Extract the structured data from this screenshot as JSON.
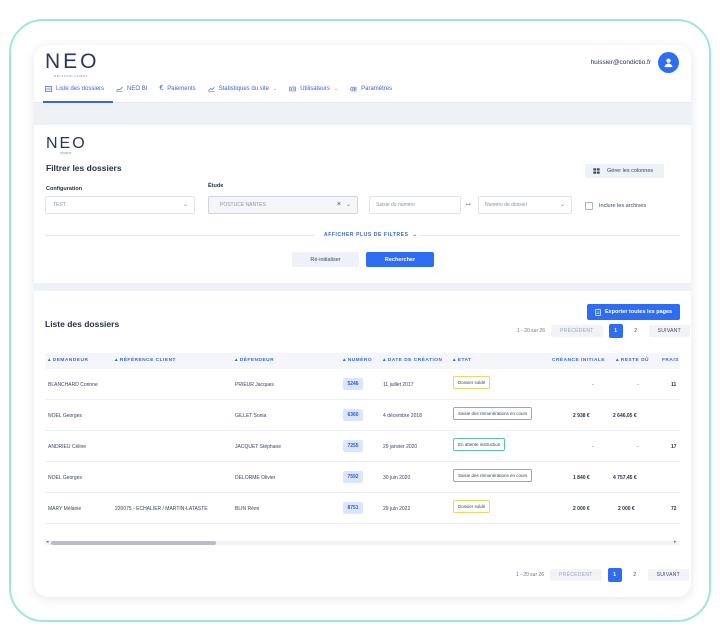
{
  "app": {
    "logo_text": "NEO",
    "logo_subtext": "RELATION CLIENT",
    "user_email": "huissier@condictio.fr"
  },
  "nav": {
    "items": [
      {
        "label": "Liste des dossiers",
        "icon": "list-icon",
        "active": true,
        "has_dropdown": false
      },
      {
        "label": "NEO BI",
        "icon": "chart-line-icon",
        "active": false,
        "has_dropdown": false
      },
      {
        "label": "Paiements",
        "icon": "euro-icon",
        "active": false,
        "has_dropdown": false
      },
      {
        "label": "Statistiques du site",
        "icon": "trend-icon",
        "active": false,
        "has_dropdown": true
      },
      {
        "label": "Utilisateurs",
        "icon": "users-icon",
        "active": false,
        "has_dropdown": true
      },
      {
        "label": "Paramètres",
        "icon": "settings-icon",
        "active": false,
        "has_dropdown": false
      }
    ]
  },
  "filters": {
    "logo_text": "NEO",
    "logo_subtext": "PRODUIT",
    "title": "Filtrer les dossiers",
    "columns_button": "Gérer les colonnes",
    "configuration_label": "Configuration",
    "configuration_value": "TEST",
    "etude_label": "Étude",
    "etude_value": "POSTUCE NANTES",
    "numero_placeholder": "Saisie du numéro",
    "dossier_placeholder": "Numéro de dossier",
    "include_archives_label": "Inclure les archives",
    "more_filters_link": "AFFICHER PLUS DE FILTRES",
    "reset_button": "Ré-initialiser",
    "search_button": "Rechercher"
  },
  "list": {
    "title": "Liste des dossiers",
    "export_button": "Exporter toutes les pages",
    "pager": {
      "range": "1 - 20 sur 26",
      "prev": "PRÉCÉDENT",
      "pages": [
        "1",
        "2"
      ],
      "current": "1",
      "next": "SUIVANT"
    },
    "columns": [
      "DEMANDEUR",
      "RÉFÉRENCE CLIENT",
      "DÉFENDEUR",
      "NUMÉRO",
      "DATE DE CRÉATION",
      "ETAT",
      "CRÉANCE INITIALE",
      "RESTE DÛ",
      "FRAIS"
    ],
    "rows": [
      {
        "demandeur": "BLANCHARD Corinne",
        "reference": "",
        "defendeur": "PRIEUR Jacques",
        "numero": "5246",
        "date": "11 juillet 2017",
        "etat": "Dossier soldé",
        "etat_color": "yellow",
        "creance": "-",
        "reste": "-",
        "frais": "11"
      },
      {
        "demandeur": "NOEL Georges",
        "reference": "",
        "defendeur": "GILLET Sonia",
        "numero": "6360",
        "date": "4 décembre 2018",
        "etat": "Saisie des rémunérations en cours",
        "etat_color": "green",
        "creance": "2 938 €",
        "reste": "2 646,05 €",
        "frais": ""
      },
      {
        "demandeur": "ANDRIEU Céline",
        "reference": "",
        "defendeur": "JACQUET Stéphane",
        "numero": "7255",
        "date": "29 janvier 2020",
        "etat": "En attente instruction",
        "etat_color": "green",
        "creance": "-",
        "reste": "-",
        "frais": "17"
      },
      {
        "demandeur": "NOEL Georges",
        "reference": "",
        "defendeur": "DELORME Olivier",
        "numero": "7592",
        "date": "30 juin 2020",
        "etat": "Saisie des rémunérations en cours",
        "etat_color": "green",
        "creance": "1 840 €",
        "reste": "4 757,45 €",
        "frais": ""
      },
      {
        "demandeur": "MARY Mélanie",
        "reference": "220075 - ECHALIER / MARTIN-LATASTE",
        "defendeur": "BLIN Rémi",
        "numero": "8751",
        "date": "29 juin 2022",
        "etat": "Dossier soldé",
        "etat_color": "yellow",
        "creance": "2 000 €",
        "reste": "2 000 €",
        "frais": "72"
      }
    ],
    "bottom_pager": {
      "range": "1 - 20 sur 26",
      "prev": "PRÉCÉDENT",
      "pages": [
        "1",
        "2"
      ],
      "current": "1",
      "next": "SUIVANT"
    }
  },
  "colors": {
    "accent": "#2f6df0",
    "nav_text": "#3a66d6",
    "frame_border": "#9be8d8",
    "state_yellow": "#f0d46a",
    "state_green": "#5cc7a6"
  }
}
